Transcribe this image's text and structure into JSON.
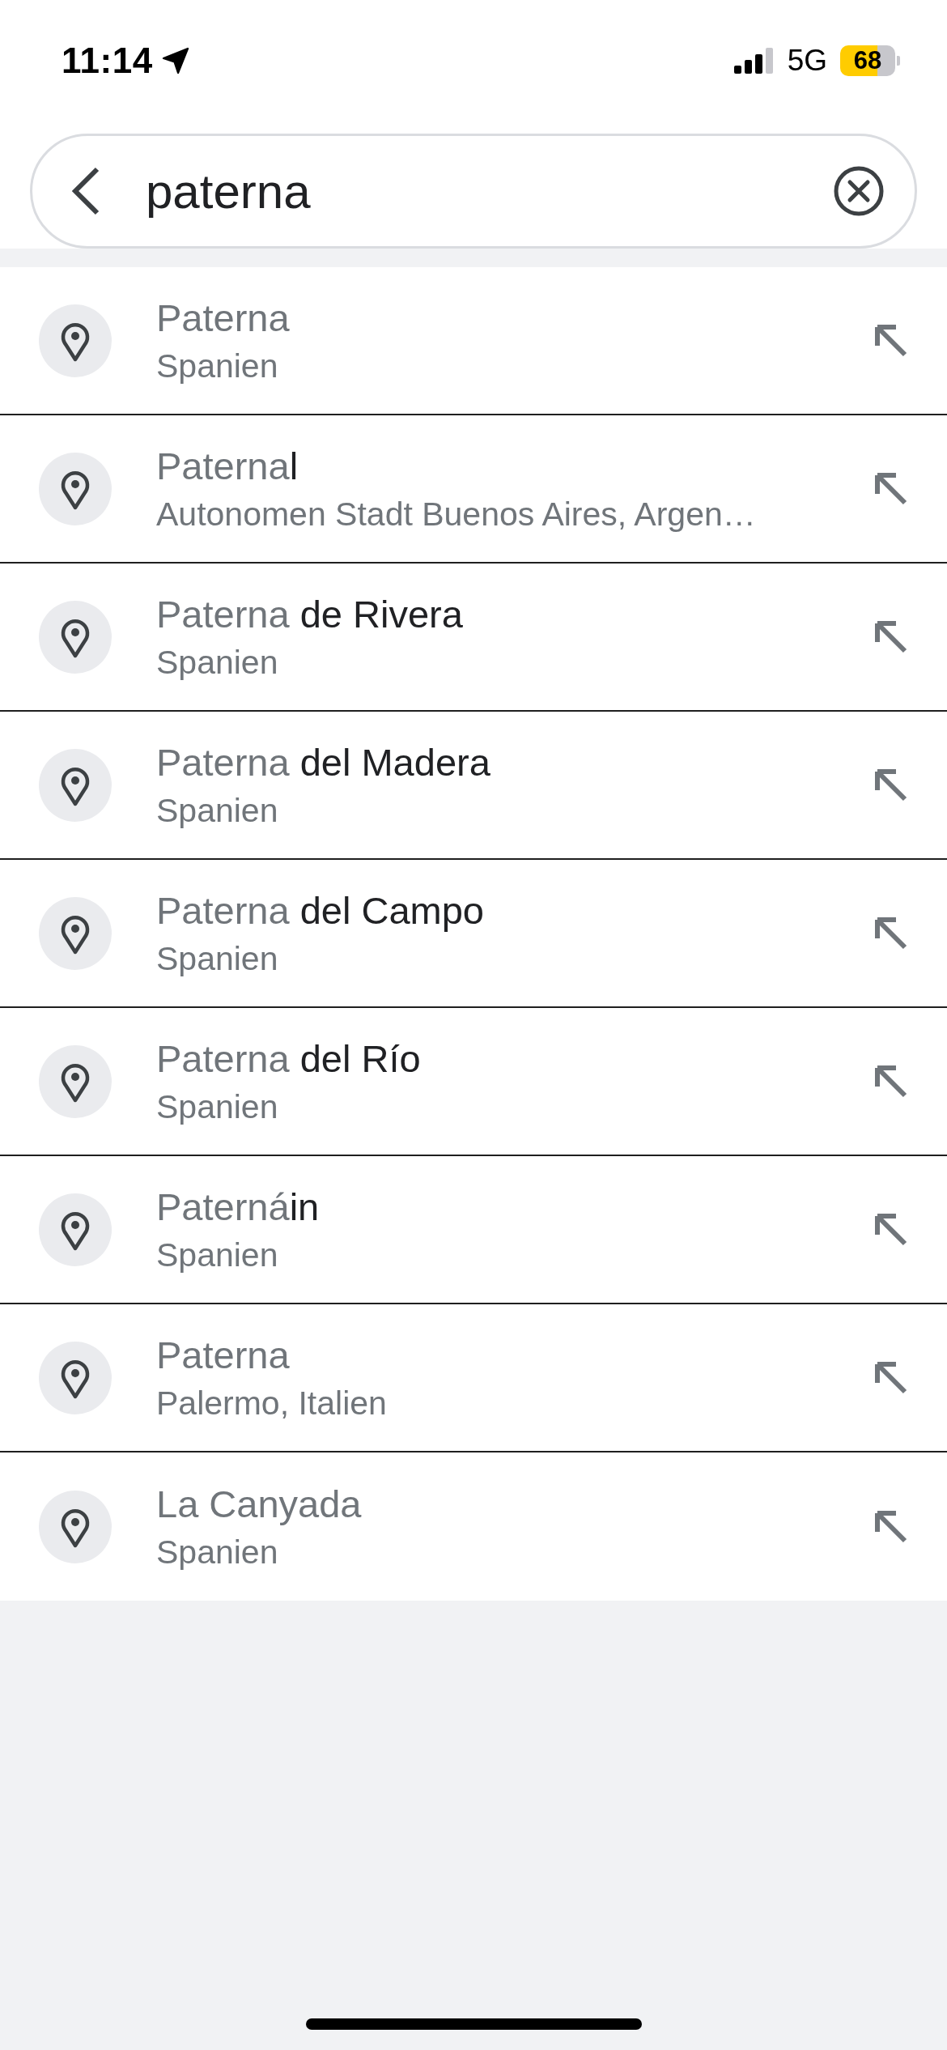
{
  "status_bar": {
    "time": "11:14",
    "network": "5G",
    "battery": "68"
  },
  "search": {
    "value": "paterna"
  },
  "suggestions": [
    {
      "title": [
        {
          "text": "Paterna",
          "emphasized": false
        }
      ],
      "subtitle": "Spanien"
    },
    {
      "title": [
        {
          "text": "Paterna",
          "emphasized": false
        },
        {
          "text": "l",
          "emphasized": true
        }
      ],
      "subtitle": "Autonomen Stadt Buenos Aires, Argen…"
    },
    {
      "title": [
        {
          "text": "Paterna",
          "emphasized": false
        },
        {
          "text": " de Rivera",
          "emphasized": true
        }
      ],
      "subtitle": "Spanien"
    },
    {
      "title": [
        {
          "text": "Paterna",
          "emphasized": false
        },
        {
          "text": " del Madera",
          "emphasized": true
        }
      ],
      "subtitle": "Spanien"
    },
    {
      "title": [
        {
          "text": "Paterna",
          "emphasized": false
        },
        {
          "text": " del Campo",
          "emphasized": true
        }
      ],
      "subtitle": "Spanien"
    },
    {
      "title": [
        {
          "text": "Paterna",
          "emphasized": false
        },
        {
          "text": " del Río",
          "emphasized": true
        }
      ],
      "subtitle": "Spanien"
    },
    {
      "title": [
        {
          "text": "Paterná",
          "emphasized": false
        },
        {
          "text": "in",
          "emphasized": true
        }
      ],
      "subtitle": "Spanien"
    },
    {
      "title": [
        {
          "text": "Paterna",
          "emphasized": false
        }
      ],
      "subtitle": "Palermo, Italien"
    },
    {
      "title": [
        {
          "text": "La Canyada",
          "emphasized": false
        }
      ],
      "subtitle": "Spanien"
    }
  ]
}
